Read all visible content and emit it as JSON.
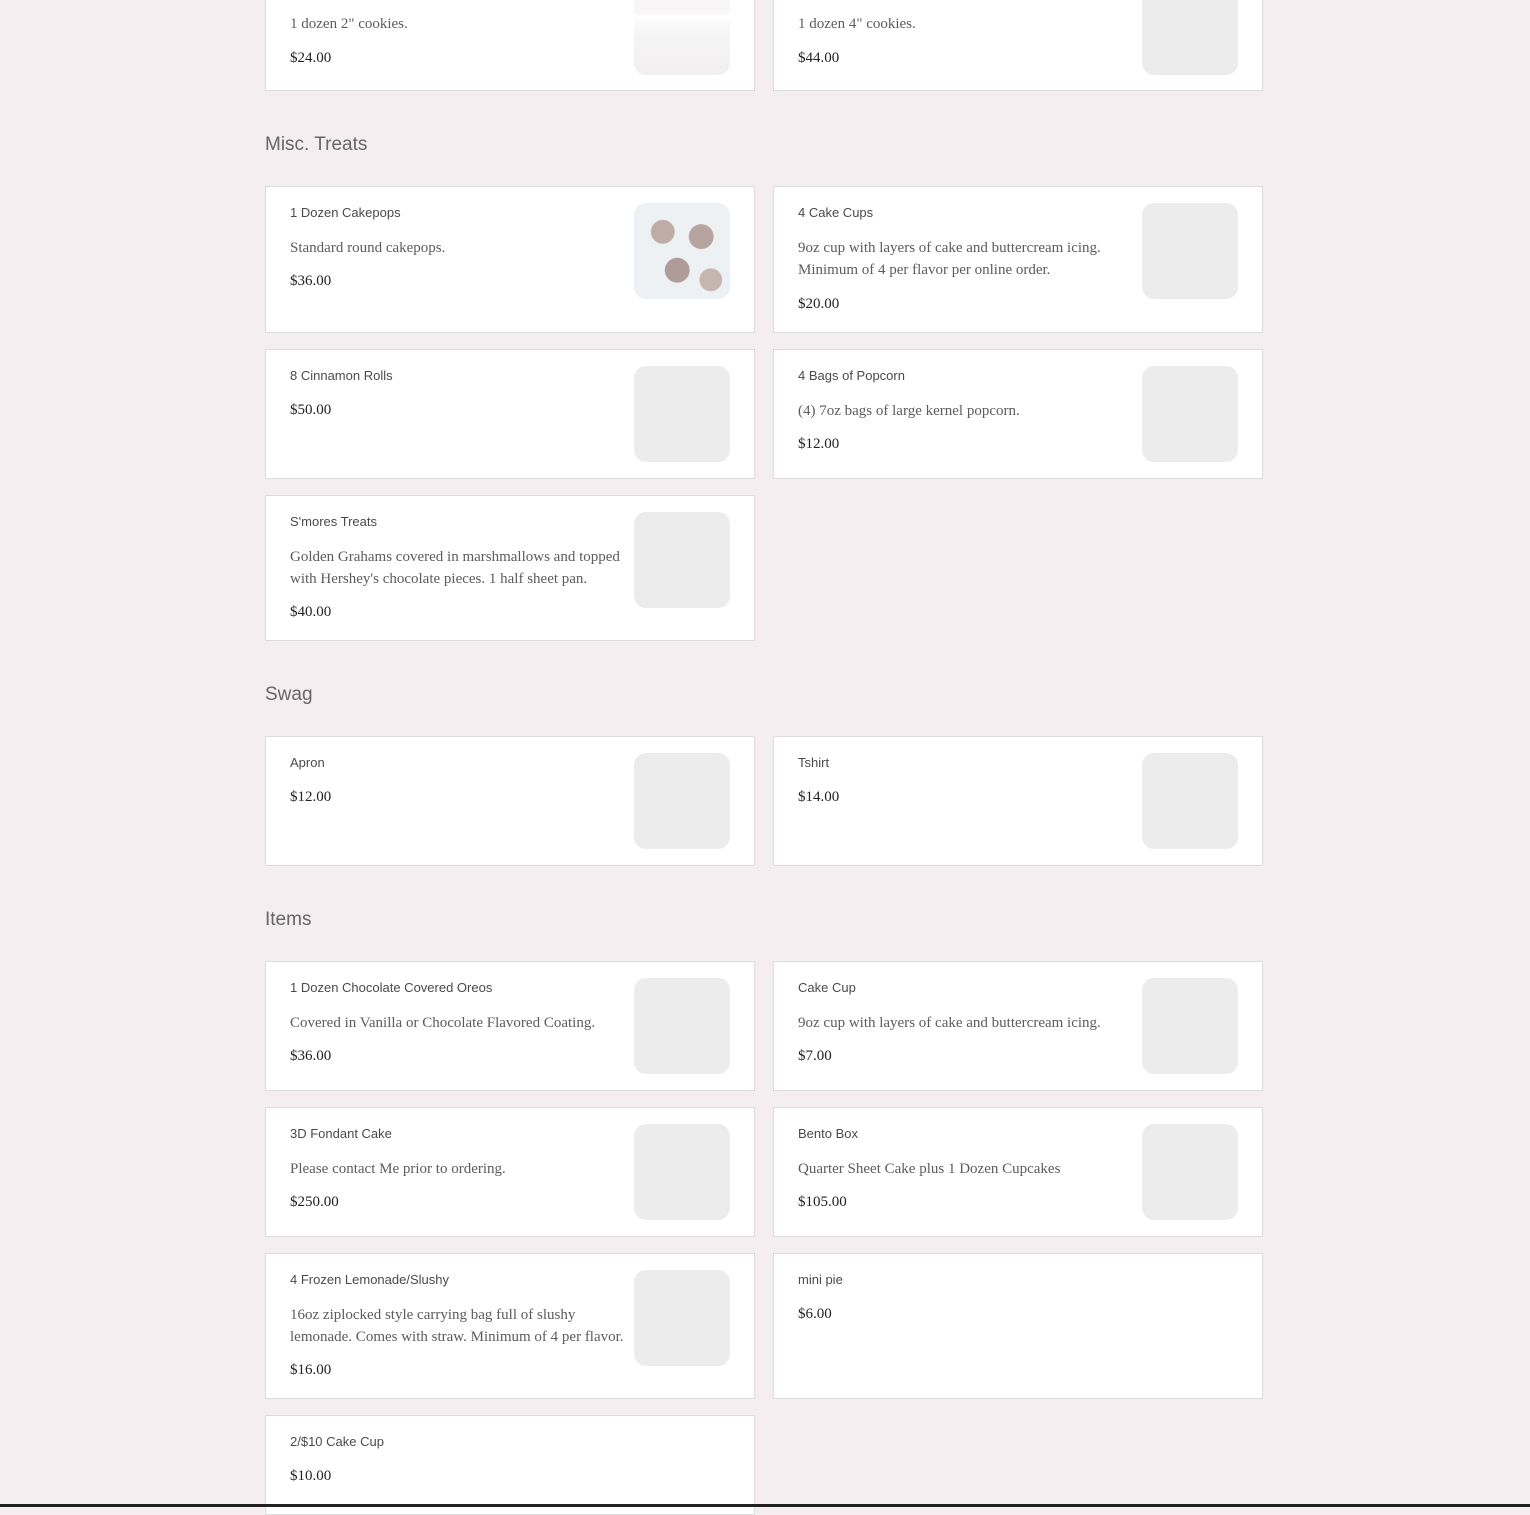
{
  "sections": {
    "misc": {
      "title": "Misc. Treats"
    },
    "swag": {
      "title": "Swag"
    },
    "items": {
      "title": "Items"
    }
  },
  "products": {
    "cookies_2in": {
      "description": "1 dozen 2\" cookies.",
      "price": "$24.00"
    },
    "cookies_4in": {
      "description": "1 dozen 4\" cookies.",
      "price": "$44.00"
    },
    "cakepops": {
      "title": "1 Dozen Cakepops",
      "description": "Standard round cakepops.",
      "price": "$36.00"
    },
    "cake_cups_4": {
      "title": "4 Cake Cups",
      "description": "9oz cup with layers of cake and buttercream icing. Minimum of 4 per flavor per online order.",
      "price": "$20.00"
    },
    "cinnamon_rolls": {
      "title": "8 Cinnamon Rolls",
      "price": "$50.00"
    },
    "popcorn": {
      "title": "4 Bags of Popcorn",
      "description": "(4) 7oz bags of large kernel popcorn.",
      "price": "$12.00"
    },
    "smores": {
      "title": "S'mores Treats",
      "description": "Golden Grahams covered in marshmallows and topped with Hershey's chocolate pieces. 1 half sheet pan.",
      "price": "$40.00"
    },
    "apron": {
      "title": "Apron",
      "price": "$12.00"
    },
    "tshirt": {
      "title": "Tshirt",
      "price": "$14.00"
    },
    "oreos": {
      "title": "1 Dozen Chocolate Covered Oreos",
      "description": "Covered in Vanilla or Chocolate Flavored Coating.",
      "price": "$36.00"
    },
    "cake_cup": {
      "title": "Cake Cup",
      "description": "9oz cup with layers of cake and buttercream icing.",
      "price": "$7.00"
    },
    "fondant": {
      "title": "3D Fondant Cake",
      "description": "Please contact Me prior to ordering.",
      "price": "$250.00"
    },
    "bento": {
      "title": "Bento Box",
      "description": "Quarter Sheet Cake plus 1 Dozen Cupcakes",
      "price": "$105.00"
    },
    "lemonade": {
      "title": "4 Frozen Lemonade/Slushy",
      "description": "16oz ziplocked style carrying bag full of slushy lemonade. Comes with straw. Minimum of 4 per flavor.",
      "price": "$16.00"
    },
    "mini_pie": {
      "title": "mini pie",
      "price": "$6.00"
    },
    "cake_cup_2for10": {
      "title": "2/$10 Cake Cup",
      "price": "$10.00"
    }
  }
}
